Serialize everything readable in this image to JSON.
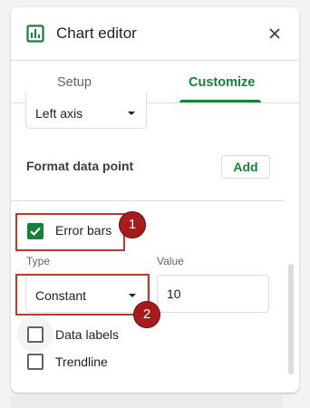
{
  "header": {
    "title": "Chart editor",
    "chart_icon": "chart-icon",
    "close_icon": "close-icon"
  },
  "tabs": [
    {
      "label": "Setup",
      "selected": false
    },
    {
      "label": "Customize",
      "selected": true
    }
  ],
  "axis_select": {
    "value": "Left axis",
    "caret_icon": "dropdown-caret-icon"
  },
  "format_data_point": {
    "label": "Format data point",
    "add_label": "Add"
  },
  "error_bars": {
    "label": "Error bars",
    "checked": true,
    "check_icon": "checkmark-icon"
  },
  "error_type": {
    "caption": "Type",
    "value": "Constant",
    "caret_icon": "dropdown-caret-icon"
  },
  "error_value": {
    "caption": "Value",
    "value": "10"
  },
  "data_labels": {
    "label": "Data labels",
    "checked": false
  },
  "trendline": {
    "label": "Trendline",
    "checked": false
  },
  "annotations": [
    {
      "number": "1"
    },
    {
      "number": "2"
    }
  ],
  "colors": {
    "accent": "#188038",
    "annotation_red": "#a61b1b",
    "highlight_border": "#c0392b"
  }
}
